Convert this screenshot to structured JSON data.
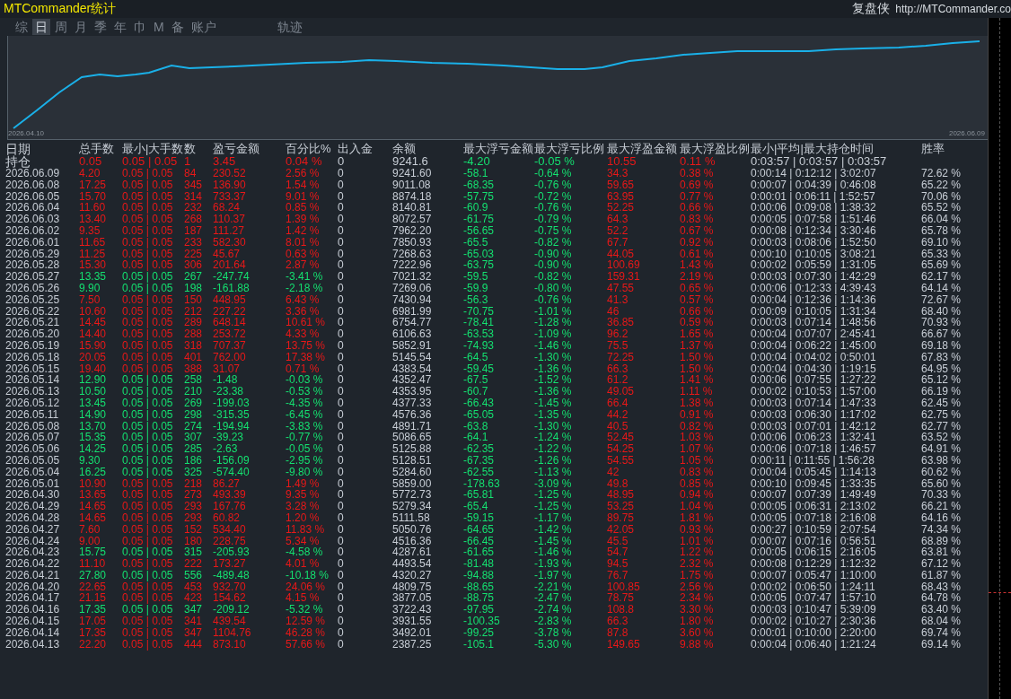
{
  "app": {
    "title": "MTCommander统计",
    "brand": "复盘侠",
    "url": "http://MTCommander.co"
  },
  "tabs": [
    {
      "label": "综",
      "selected": false
    },
    {
      "label": "日",
      "selected": true
    },
    {
      "label": "周",
      "selected": false
    },
    {
      "label": "月",
      "selected": false
    },
    {
      "label": "季",
      "selected": false
    },
    {
      "label": "年",
      "selected": false
    },
    {
      "label": "巾",
      "selected": false
    },
    {
      "label": "M",
      "selected": false
    },
    {
      "label": "备",
      "selected": false
    },
    {
      "label": "账户",
      "selected": false
    },
    {
      "label": "轨迹",
      "selected": false
    }
  ],
  "chart": {
    "start_label": "2026.04.10",
    "end_label": "2026.06.09"
  },
  "table": {
    "columns": [
      "日期",
      "总手数",
      "最小|大手数",
      "数",
      "盈亏金额",
      "百分比%",
      "出入金",
      "余额",
      "最大浮亏金额",
      "最大浮亏比例",
      "最大浮盈金额",
      "最大浮盈比例",
      "最小|平均|最大持仓时间",
      "胜率"
    ],
    "holding": {
      "loss": false,
      "cells": [
        "持仓",
        "0.05",
        "0.05 | 0.05",
        "1",
        "3.45",
        "0.04 %",
        "0",
        "9241.6",
        "-4.20",
        "-0.05 %",
        "10.55",
        "0.11 %",
        "0:03:57 | 0:03:57 | 0:03:57"
      ]
    },
    "rows": [
      {
        "loss": false,
        "cells": [
          "2026.06.09",
          "4.20",
          "0.05 | 0.05",
          "84",
          "230.52",
          "2.56 %",
          "0",
          "9241.60",
          "-58.1",
          "-0.64 %",
          "34.3",
          "0.38 %",
          "0:00:14 | 0:12:12 | 3:02:07",
          "72.62 %"
        ]
      },
      {
        "loss": false,
        "cells": [
          "2026.06.08",
          "17.25",
          "0.05 | 0.05",
          "345",
          "136.90",
          "1.54 %",
          "0",
          "9011.08",
          "-68.35",
          "-0.76 %",
          "59.65",
          "0.69 %",
          "0:00:07 | 0:04:39 | 0:46:08",
          "65.22 %"
        ]
      },
      {
        "loss": false,
        "cells": [
          "2026.06.05",
          "15.70",
          "0.05 | 0.05",
          "314",
          "733.37",
          "9.01 %",
          "0",
          "8874.18",
          "-57.75",
          "-0.72 %",
          "63.95",
          "0.77 %",
          "0:00:01 | 0:06:11 | 1:52:57",
          "70.06 %"
        ]
      },
      {
        "loss": false,
        "cells": [
          "2026.06.04",
          "11.60",
          "0.05 | 0.05",
          "232",
          "68.24",
          "0.85 %",
          "0",
          "8140.81",
          "-60.9",
          "-0.76 %",
          "52.25",
          "0.66 %",
          "0:00:06 | 0:09:08 | 1:38:32",
          "65.52 %"
        ]
      },
      {
        "loss": false,
        "cells": [
          "2026.06.03",
          "13.40",
          "0.05 | 0.05",
          "268",
          "110.37",
          "1.39 %",
          "0",
          "8072.57",
          "-61.75",
          "-0.79 %",
          "64.3",
          "0.83 %",
          "0:00:05 | 0:07:58 | 1:51:46",
          "66.04 %"
        ]
      },
      {
        "loss": false,
        "cells": [
          "2026.06.02",
          "9.35",
          "0.05 | 0.05",
          "187",
          "111.27",
          "1.42 %",
          "0",
          "7962.20",
          "-56.65",
          "-0.75 %",
          "52.2",
          "0.67 %",
          "0:00:08 | 0:12:34 | 3:30:46",
          "65.78 %"
        ]
      },
      {
        "loss": false,
        "cells": [
          "2026.06.01",
          "11.65",
          "0.05 | 0.05",
          "233",
          "582.30",
          "8.01 %",
          "0",
          "7850.93",
          "-65.5",
          "-0.82 %",
          "67.7",
          "0.92 %",
          "0:00:03 | 0:08:06 | 1:52:50",
          "69.10 %"
        ]
      },
      {
        "loss": false,
        "cells": [
          "2026.05.29",
          "11.25",
          "0.05 | 0.05",
          "225",
          "45.67",
          "0.63 %",
          "0",
          "7268.63",
          "-65.03",
          "-0.90 %",
          "44.05",
          "0.61 %",
          "0:00:10 | 0:10:05 | 3:08:21",
          "65.33 %"
        ]
      },
      {
        "loss": false,
        "cells": [
          "2026.05.28",
          "15.30",
          "0.05 | 0.05",
          "306",
          "201.64",
          "2.87 %",
          "0",
          "7222.96",
          "-63.75",
          "-0.90 %",
          "100.69",
          "1.43 %",
          "0:00:02 | 0:05:59 | 1:31:05",
          "65.69 %"
        ]
      },
      {
        "loss": true,
        "cells": [
          "2026.05.27",
          "13.35",
          "0.05 | 0.05",
          "267",
          "-247.74",
          "-3.41 %",
          "0",
          "7021.32",
          "-59.5",
          "-0.82 %",
          "159.31",
          "2.19 %",
          "0:00:03 | 0:07:30 | 1:42:29",
          "62.17 %"
        ]
      },
      {
        "loss": true,
        "cells": [
          "2026.05.26",
          "9.90",
          "0.05 | 0.05",
          "198",
          "-161.88",
          "-2.18 %",
          "0",
          "7269.06",
          "-59.9",
          "-0.80 %",
          "47.55",
          "0.65 %",
          "0:00:06 | 0:12:33 | 4:39:43",
          "64.14 %"
        ]
      },
      {
        "loss": false,
        "cells": [
          "2026.05.25",
          "7.50",
          "0.05 | 0.05",
          "150",
          "448.95",
          "6.43 %",
          "0",
          "7430.94",
          "-56.3",
          "-0.76 %",
          "41.3",
          "0.57 %",
          "0:00:04 | 0:12:36 | 1:14:36",
          "72.67 %"
        ]
      },
      {
        "loss": false,
        "cells": [
          "2026.05.22",
          "10.60",
          "0.05 | 0.05",
          "212",
          "227.22",
          "3.36 %",
          "0",
          "6981.99",
          "-70.75",
          "-1.01 %",
          "46",
          "0.66 %",
          "0:00:09 | 0:10:05 | 1:31:34",
          "68.40 %"
        ]
      },
      {
        "loss": false,
        "cells": [
          "2026.05.21",
          "14.45",
          "0.05 | 0.05",
          "289",
          "648.14",
          "10.61 %",
          "0",
          "6754.77",
          "-78.41",
          "-1.28 %",
          "36.85",
          "0.59 %",
          "0:00:03 | 0:07:14 | 1:48:56",
          "70.93 %"
        ]
      },
      {
        "loss": false,
        "cells": [
          "2026.05.20",
          "14.40",
          "0.05 | 0.05",
          "288",
          "253.72",
          "4.33 %",
          "0",
          "6106.63",
          "-63.53",
          "-1.09 %",
          "96.2",
          "1.65 %",
          "0:00:04 | 0:07:07 | 2:45:41",
          "66.67 %"
        ]
      },
      {
        "loss": false,
        "cells": [
          "2026.05.19",
          "15.90",
          "0.05 | 0.05",
          "318",
          "707.37",
          "13.75 %",
          "0",
          "5852.91",
          "-74.93",
          "-1.46 %",
          "75.5",
          "1.37 %",
          "0:00:04 | 0:06:22 | 1:45:00",
          "69.18 %"
        ]
      },
      {
        "loss": false,
        "cells": [
          "2026.05.18",
          "20.05",
          "0.05 | 0.05",
          "401",
          "762.00",
          "17.38 %",
          "0",
          "5145.54",
          "-64.5",
          "-1.30 %",
          "72.25",
          "1.50 %",
          "0:00:04 | 0:04:02 | 0:50:01",
          "67.83 %"
        ]
      },
      {
        "loss": false,
        "cells": [
          "2026.05.15",
          "19.40",
          "0.05 | 0.05",
          "388",
          "31.07",
          "0.71 %",
          "0",
          "4383.54",
          "-59.45",
          "-1.36 %",
          "66.3",
          "1.50 %",
          "0:00:04 | 0:04:30 | 1:19:15",
          "64.95 %"
        ]
      },
      {
        "loss": true,
        "cells": [
          "2026.05.14",
          "12.90",
          "0.05 | 0.05",
          "258",
          "-1.48",
          "-0.03 %",
          "0",
          "4352.47",
          "-67.5",
          "-1.52 %",
          "61.2",
          "1.41 %",
          "0:00:06 | 0:07:55 | 1:27:22",
          "65.12 %"
        ]
      },
      {
        "loss": true,
        "cells": [
          "2026.05.13",
          "10.50",
          "0.05 | 0.05",
          "210",
          "-23.38",
          "-0.53 %",
          "0",
          "4353.95",
          "-60.7",
          "-1.36 %",
          "49.05",
          "1.11 %",
          "0:00:02 | 0:10:53 | 1:57:00",
          "66.19 %"
        ]
      },
      {
        "loss": true,
        "cells": [
          "2026.05.12",
          "13.45",
          "0.05 | 0.05",
          "269",
          "-199.03",
          "-4.35 %",
          "0",
          "4377.33",
          "-66.43",
          "-1.45 %",
          "66.4",
          "1.38 %",
          "0:00:03 | 0:07:14 | 1:47:33",
          "62.45 %"
        ]
      },
      {
        "loss": true,
        "cells": [
          "2026.05.11",
          "14.90",
          "0.05 | 0.05",
          "298",
          "-315.35",
          "-6.45 %",
          "0",
          "4576.36",
          "-65.05",
          "-1.35 %",
          "44.2",
          "0.91 %",
          "0:00:03 | 0:06:30 | 1:17:02",
          "62.75 %"
        ]
      },
      {
        "loss": true,
        "cells": [
          "2026.05.08",
          "13.70",
          "0.05 | 0.05",
          "274",
          "-194.94",
          "-3.83 %",
          "0",
          "4891.71",
          "-63.8",
          "-1.30 %",
          "40.5",
          "0.82 %",
          "0:00:03 | 0:07:01 | 1:42:12",
          "62.77 %"
        ]
      },
      {
        "loss": true,
        "cells": [
          "2026.05.07",
          "15.35",
          "0.05 | 0.05",
          "307",
          "-39.23",
          "-0.77 %",
          "0",
          "5086.65",
          "-64.1",
          "-1.24 %",
          "52.45",
          "1.03 %",
          "0:00:06 | 0:06:23 | 1:32:41",
          "63.52 %"
        ]
      },
      {
        "loss": true,
        "cells": [
          "2026.05.06",
          "14.25",
          "0.05 | 0.05",
          "285",
          "-2.63",
          "-0.05 %",
          "0",
          "5125.88",
          "-62.35",
          "-1.22 %",
          "54.25",
          "1.07 %",
          "0:00:06 | 0:07:18 | 1:46:57",
          "64.91 %"
        ]
      },
      {
        "loss": true,
        "cells": [
          "2026.05.05",
          "9.30",
          "0.05 | 0.05",
          "186",
          "-156.09",
          "-2.95 %",
          "0",
          "5128.51",
          "-67.35",
          "-1.26 %",
          "54.55",
          "1.05 %",
          "0:00:11 | 0:11:55 | 1:56:28",
          "63.98 %"
        ]
      },
      {
        "loss": true,
        "cells": [
          "2026.05.04",
          "16.25",
          "0.05 | 0.05",
          "325",
          "-574.40",
          "-9.80 %",
          "0",
          "5284.60",
          "-62.55",
          "-1.13 %",
          "42",
          "0.83 %",
          "0:00:04 | 0:05:45 | 1:14:13",
          "60.62 %"
        ]
      },
      {
        "loss": false,
        "cells": [
          "2026.05.01",
          "10.90",
          "0.05 | 0.05",
          "218",
          "86.27",
          "1.49 %",
          "0",
          "5859.00",
          "-178.63",
          "-3.09 %",
          "49.8",
          "0.85 %",
          "0:00:10 | 0:09:45 | 1:33:35",
          "65.60 %"
        ]
      },
      {
        "loss": false,
        "cells": [
          "2026.04.30",
          "13.65",
          "0.05 | 0.05",
          "273",
          "493.39",
          "9.35 %",
          "0",
          "5772.73",
          "-65.81",
          "-1.25 %",
          "48.95",
          "0.94 %",
          "0:00:07 | 0:07:39 | 1:49:49",
          "70.33 %"
        ]
      },
      {
        "loss": false,
        "cells": [
          "2026.04.29",
          "14.65",
          "0.05 | 0.05",
          "293",
          "167.76",
          "3.28 %",
          "0",
          "5279.34",
          "-65.4",
          "-1.25 %",
          "53.25",
          "1.04 %",
          "0:00:05 | 0:06:31 | 2:13:02",
          "66.21 %"
        ]
      },
      {
        "loss": false,
        "cells": [
          "2026.04.28",
          "14.65",
          "0.05 | 0.05",
          "293",
          "60.82",
          "1.20 %",
          "0",
          "5111.58",
          "-59.15",
          "-1.17 %",
          "89.75",
          "1.81 %",
          "0:00:05 | 0:07:18 | 2:16:08",
          "64.16 %"
        ]
      },
      {
        "loss": false,
        "cells": [
          "2026.04.27",
          "7.60",
          "0.05 | 0.05",
          "152",
          "534.40",
          "11.83 %",
          "0",
          "5050.76",
          "-64.65",
          "-1.42 %",
          "42.05",
          "0.93 %",
          "0:00:27 | 0:10:59 | 2:07:54",
          "74.34 %"
        ]
      },
      {
        "loss": false,
        "cells": [
          "2026.04.24",
          "9.00",
          "0.05 | 0.05",
          "180",
          "228.75",
          "5.34 %",
          "0",
          "4516.36",
          "-66.45",
          "-1.45 %",
          "45.5",
          "1.01 %",
          "0:00:07 | 0:07:16 | 0:56:51",
          "68.89 %"
        ]
      },
      {
        "loss": true,
        "cells": [
          "2026.04.23",
          "15.75",
          "0.05 | 0.05",
          "315",
          "-205.93",
          "-4.58 %",
          "0",
          "4287.61",
          "-61.65",
          "-1.46 %",
          "54.7",
          "1.22 %",
          "0:00:05 | 0:06:15 | 2:16:05",
          "63.81 %"
        ]
      },
      {
        "loss": false,
        "cells": [
          "2026.04.22",
          "11.10",
          "0.05 | 0.05",
          "222",
          "173.27",
          "4.01 %",
          "0",
          "4493.54",
          "-81.48",
          "-1.93 %",
          "94.5",
          "2.32 %",
          "0:00:08 | 0:12:29 | 1:12:32",
          "67.12 %"
        ]
      },
      {
        "loss": true,
        "cells": [
          "2026.04.21",
          "27.80",
          "0.05 | 0.05",
          "556",
          "-489.48",
          "-10.18 %",
          "0",
          "4320.27",
          "-94.88",
          "-1.97 %",
          "76.7",
          "1.75 %",
          "0:00:07 | 0:05:47 | 1:10:00",
          "61.87 %"
        ]
      },
      {
        "loss": false,
        "cells": [
          "2026.04.20",
          "22.65",
          "0.05 | 0.05",
          "453",
          "932.70",
          "24.06 %",
          "0",
          "4809.75",
          "-88.65",
          "-2.21 %",
          "100.85",
          "2.56 %",
          "0:00:02 | 0:06:50 | 1:24:11",
          "68.43 %"
        ]
      },
      {
        "loss": false,
        "cells": [
          "2026.04.17",
          "21.15",
          "0.05 | 0.05",
          "423",
          "154.62",
          "4.15 %",
          "0",
          "3877.05",
          "-88.75",
          "-2.47 %",
          "78.75",
          "2.34 %",
          "0:00:05 | 0:07:47 | 1:57:10",
          "64.78 %"
        ]
      },
      {
        "loss": true,
        "cells": [
          "2026.04.16",
          "17.35",
          "0.05 | 0.05",
          "347",
          "-209.12",
          "-5.32 %",
          "0",
          "3722.43",
          "-97.95",
          "-2.74 %",
          "108.8",
          "3.30 %",
          "0:00:03 | 0:10:47 | 5:39:09",
          "63.40 %"
        ]
      },
      {
        "loss": false,
        "cells": [
          "2026.04.15",
          "17.05",
          "0.05 | 0.05",
          "341",
          "439.54",
          "12.59 %",
          "0",
          "3931.55",
          "-100.35",
          "-2.83 %",
          "66.3",
          "1.80 %",
          "0:00:02 | 0:10:27 | 2:30:36",
          "68.04 %"
        ]
      },
      {
        "loss": false,
        "cells": [
          "2026.04.14",
          "17.35",
          "0.05 | 0.05",
          "347",
          "1104.76",
          "46.28 %",
          "0",
          "3492.01",
          "-99.25",
          "-3.78 %",
          "87.8",
          "3.60 %",
          "0:00:01 | 0:10:00 | 2:20:00",
          "69.74 %"
        ]
      },
      {
        "loss": false,
        "cells": [
          "2026.04.13",
          "22.20",
          "0.05 | 0.05",
          "444",
          "873.10",
          "57.66 %",
          "0",
          "2387.25",
          "-105.1",
          "-5.30 %",
          "149.65",
          "9.88 %",
          "0:00:04 | 0:06:40 | 1:21:24",
          "69.14 %"
        ]
      }
    ]
  }
}
